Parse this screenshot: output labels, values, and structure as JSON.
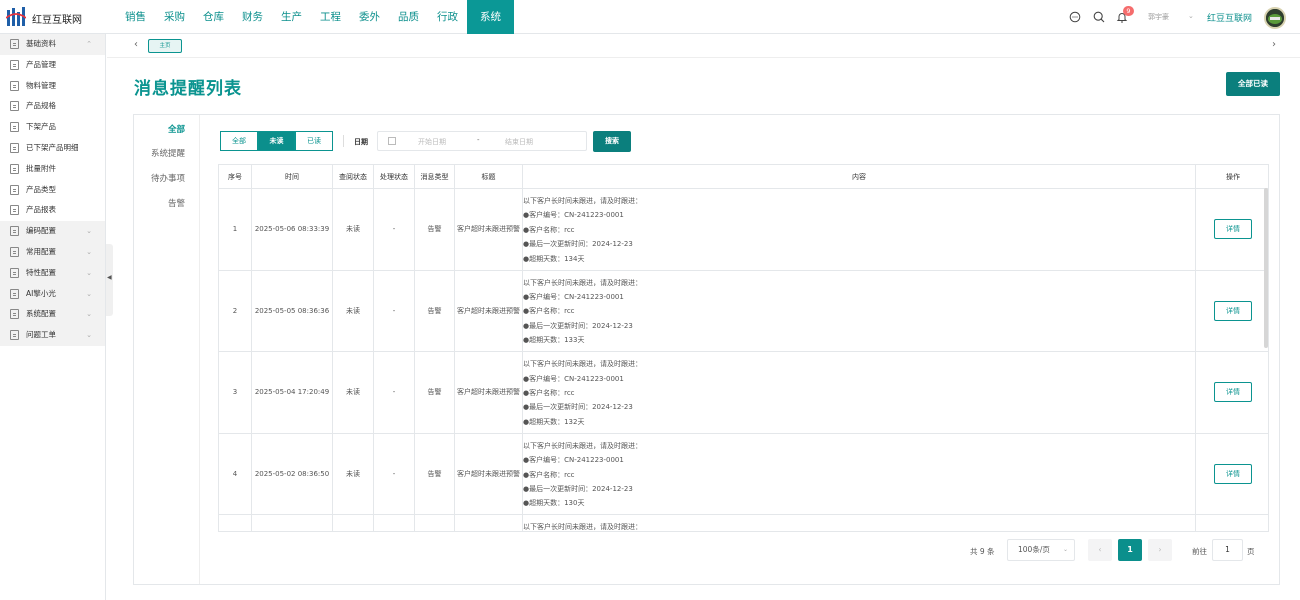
{
  "app": {
    "brand": "红豆互联网"
  },
  "nav": {
    "items": [
      "销售",
      "采购",
      "仓库",
      "财务",
      "生产",
      "工程",
      "委外",
      "品质",
      "行政",
      "系统"
    ],
    "active_index": 9
  },
  "header": {
    "notification_count": "9",
    "user_alt": "郭宇豪",
    "user_name": "红豆互联网"
  },
  "sidebar": {
    "items": [
      {
        "label": "基础资料",
        "group": true,
        "expanded": true
      },
      {
        "label": "产品管理"
      },
      {
        "label": "物料管理"
      },
      {
        "label": "产品规格"
      },
      {
        "label": "下架产品"
      },
      {
        "label": "已下架产品明细"
      },
      {
        "label": "批量附件"
      },
      {
        "label": "产品类型"
      },
      {
        "label": "产品报表"
      },
      {
        "label": "编码配置",
        "group": true
      },
      {
        "label": "常用配置",
        "group": true
      },
      {
        "label": "特性配置",
        "group": true
      },
      {
        "label": "AI擎小光",
        "group": true
      },
      {
        "label": "系统配置",
        "group": true
      },
      {
        "label": "问题工单",
        "group": true
      }
    ]
  },
  "breadcrumb": {
    "tag": "主页"
  },
  "page": {
    "title": "消息提醒列表",
    "read_all": "全部已读"
  },
  "tabs": [
    {
      "label": "全部",
      "active": true
    },
    {
      "label": "系统提醒"
    },
    {
      "label": "待办事项"
    },
    {
      "label": "告警"
    }
  ],
  "filters": {
    "status_options": [
      "全部",
      "未读",
      "已读"
    ],
    "status_active": 1,
    "date_label": "日期",
    "date_start_placeholder": "开始日期",
    "date_sep": "-",
    "date_end_placeholder": "结束日期",
    "search_label": "搜索"
  },
  "table": {
    "columns": [
      "序号",
      "时间",
      "查阅状态",
      "处理状态",
      "消息类型",
      "标题",
      "内容",
      "操作"
    ],
    "detail_label": "详情",
    "rows": [
      {
        "no": "1",
        "time": "2025-05-06 08:33:39",
        "read": "未读",
        "handle": "-",
        "type": "告警",
        "title": "客户超时未跟进预警",
        "content": [
          "以下客户长时间未跟进，请及时跟进：",
          "●客户编号：CN-241223-0001",
          "●客户名称：rcc",
          "●最后一次更新时间：2024-12-23",
          "●超期天数：134天"
        ]
      },
      {
        "no": "2",
        "time": "2025-05-05 08:36:36",
        "read": "未读",
        "handle": "-",
        "type": "告警",
        "title": "客户超时未跟进预警",
        "content": [
          "以下客户长时间未跟进，请及时跟进：",
          "●客户编号：CN-241223-0001",
          "●客户名称：rcc",
          "●最后一次更新时间：2024-12-23",
          "●超期天数：133天"
        ]
      },
      {
        "no": "3",
        "time": "2025-05-04 17:20:49",
        "read": "未读",
        "handle": "-",
        "type": "告警",
        "title": "客户超时未跟进预警",
        "content": [
          "以下客户长时间未跟进，请及时跟进：",
          "●客户编号：CN-241223-0001",
          "●客户名称：rcc",
          "●最后一次更新时间：2024-12-23",
          "●超期天数：132天"
        ]
      },
      {
        "no": "4",
        "time": "2025-05-02 08:36:50",
        "read": "未读",
        "handle": "-",
        "type": "告警",
        "title": "客户超时未跟进预警",
        "content": [
          "以下客户长时间未跟进，请及时跟进：",
          "●客户编号：CN-241223-0001",
          "●客户名称：rcc",
          "●最后一次更新时间：2024-12-23",
          "●超期天数：130天"
        ]
      },
      {
        "no": "",
        "time": "",
        "read": "",
        "handle": "",
        "type": "",
        "title": "",
        "content": [
          "以下客户长时间未跟进，请及时跟进："
        ]
      }
    ]
  },
  "pagination": {
    "total": "共 9 条",
    "page_size": "100条/页",
    "prev": "‹",
    "current": "1",
    "next": "›",
    "goto_label": "前往",
    "goto_value": "1",
    "page_suffix": "页"
  }
}
